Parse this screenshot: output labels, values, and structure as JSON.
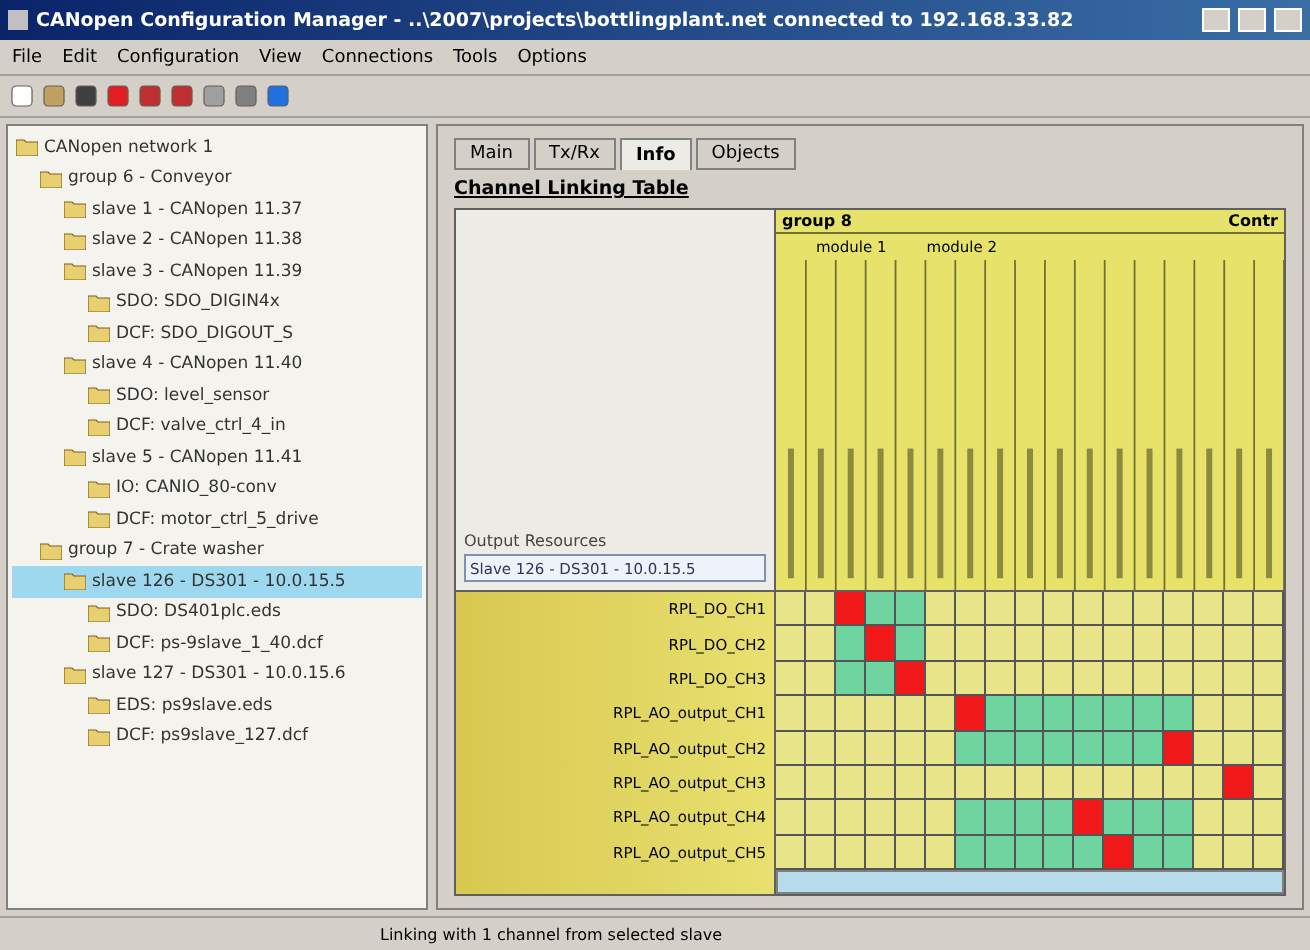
{
  "window": {
    "title": "CANopen Configuration Manager - ..\\2007\\projects\\bottlingplant.net connected to 192.168.33.82"
  },
  "menu": [
    "File",
    "Edit",
    "Configuration",
    "View",
    "Connections",
    "Tools",
    "Options"
  ],
  "tree": [
    {
      "label": "CANopen network 1",
      "selected": false,
      "children": [
        {
          "label": "group 6 - Conveyor",
          "selected": false,
          "children": [
            {
              "label": "slave 1 - CANopen 11.37",
              "selected": false
            },
            {
              "label": "slave 2 - CANopen 11.38",
              "selected": false
            },
            {
              "label": "slave 3 - CANopen 11.39",
              "selected": false,
              "children": [
                {
                  "label": "SDO: SDO_DIGIN4x",
                  "selected": false
                },
                {
                  "label": "DCF: SDO_DIGOUT_S",
                  "selected": false
                }
              ]
            },
            {
              "label": "slave 4 - CANopen 11.40",
              "selected": false,
              "children": [
                {
                  "label": "SDO: level_sensor",
                  "selected": false
                },
                {
                  "label": "DCF: valve_ctrl_4_in",
                  "selected": false
                }
              ]
            },
            {
              "label": "slave 5 - CANopen 11.41",
              "selected": false,
              "children": [
                {
                  "label": "IO: CANIO_80-conv",
                  "selected": false
                },
                {
                  "label": "DCF: motor_ctrl_5_drive",
                  "selected": false
                }
              ]
            }
          ]
        },
        {
          "label": "group 7 - Crate washer",
          "selected": false,
          "children": [
            {
              "label": "slave 126 - DS301 - 10.0.15.5",
              "selected": true,
              "children": [
                {
                  "label": "SDO: DS401plc.eds",
                  "selected": false
                },
                {
                  "label": "DCF: ps-9slave_1_40.dcf",
                  "selected": false
                }
              ]
            },
            {
              "label": "slave 127 - DS301 - 10.0.15.6",
              "selected": false,
              "children": [
                {
                  "label": "EDS: ps9slave.eds",
                  "selected": false
                },
                {
                  "label": "DCF: ps9slave_127.dcf",
                  "selected": false
                }
              ]
            }
          ]
        }
      ]
    }
  ],
  "tabs": [
    {
      "label": "Main",
      "selected": false
    },
    {
      "label": "Tx/Rx",
      "selected": false
    },
    {
      "label": "Info",
      "selected": true
    },
    {
      "label": "Objects",
      "selected": false
    }
  ],
  "heading": "Channel Linking Table",
  "output_resources": {
    "label": "Output Resources",
    "value": "Slave 126 - DS301 - 10.0.15.5"
  },
  "column_groups": [
    {
      "label": "group 8"
    },
    {
      "label": "Contr"
    }
  ],
  "modules": [
    {
      "label": "module 1"
    },
    {
      "label": "module 2"
    }
  ],
  "rows": [
    {
      "label": "RPL_DO_CH1",
      "cells": [
        {
          "kind": "none"
        },
        {
          "kind": "none"
        },
        {
          "kind": "linked"
        },
        {
          "kind": "available"
        },
        {
          "kind": "available"
        },
        {
          "kind": "none"
        },
        {
          "kind": "none"
        },
        {
          "kind": "none"
        },
        {
          "kind": "none"
        },
        {
          "kind": "none"
        },
        {
          "kind": "none"
        },
        {
          "kind": "none"
        },
        {
          "kind": "none"
        },
        {
          "kind": "none"
        },
        {
          "kind": "none"
        },
        {
          "kind": "none"
        },
        {
          "kind": "none"
        }
      ]
    },
    {
      "label": "RPL_DO_CH2",
      "cells": [
        {
          "kind": "none"
        },
        {
          "kind": "none"
        },
        {
          "kind": "available"
        },
        {
          "kind": "linked"
        },
        {
          "kind": "available"
        },
        {
          "kind": "none"
        },
        {
          "kind": "none"
        },
        {
          "kind": "none"
        },
        {
          "kind": "none"
        },
        {
          "kind": "none"
        },
        {
          "kind": "none"
        },
        {
          "kind": "none"
        },
        {
          "kind": "none"
        },
        {
          "kind": "none"
        },
        {
          "kind": "none"
        },
        {
          "kind": "none"
        },
        {
          "kind": "none"
        }
      ]
    },
    {
      "label": "RPL_DO_CH3",
      "cells": [
        {
          "kind": "none"
        },
        {
          "kind": "none"
        },
        {
          "kind": "available"
        },
        {
          "kind": "available"
        },
        {
          "kind": "linked"
        },
        {
          "kind": "none"
        },
        {
          "kind": "none"
        },
        {
          "kind": "none"
        },
        {
          "kind": "none"
        },
        {
          "kind": "none"
        },
        {
          "kind": "none"
        },
        {
          "kind": "none"
        },
        {
          "kind": "none"
        },
        {
          "kind": "none"
        },
        {
          "kind": "none"
        },
        {
          "kind": "none"
        },
        {
          "kind": "none"
        }
      ]
    },
    {
      "label": "RPL_AO_output_CH1",
      "cells": [
        {
          "kind": "none"
        },
        {
          "kind": "none"
        },
        {
          "kind": "none"
        },
        {
          "kind": "none"
        },
        {
          "kind": "none"
        },
        {
          "kind": "none"
        },
        {
          "kind": "linked"
        },
        {
          "kind": "available"
        },
        {
          "kind": "available"
        },
        {
          "kind": "available"
        },
        {
          "kind": "available"
        },
        {
          "kind": "available"
        },
        {
          "kind": "available"
        },
        {
          "kind": "available"
        },
        {
          "kind": "none"
        },
        {
          "kind": "none"
        },
        {
          "kind": "none"
        }
      ]
    },
    {
      "label": "RPL_AO_output_CH2",
      "cells": [
        {
          "kind": "none"
        },
        {
          "kind": "none"
        },
        {
          "kind": "none"
        },
        {
          "kind": "none"
        },
        {
          "kind": "none"
        },
        {
          "kind": "none"
        },
        {
          "kind": "available"
        },
        {
          "kind": "available"
        },
        {
          "kind": "available"
        },
        {
          "kind": "available"
        },
        {
          "kind": "available"
        },
        {
          "kind": "available"
        },
        {
          "kind": "available"
        },
        {
          "kind": "linked"
        },
        {
          "kind": "none"
        },
        {
          "kind": "none"
        },
        {
          "kind": "none"
        }
      ]
    },
    {
      "label": "RPL_AO_output_CH3",
      "cells": [
        {
          "kind": "none"
        },
        {
          "kind": "none"
        },
        {
          "kind": "none"
        },
        {
          "kind": "none"
        },
        {
          "kind": "none"
        },
        {
          "kind": "none"
        },
        {
          "kind": "none"
        },
        {
          "kind": "none"
        },
        {
          "kind": "none"
        },
        {
          "kind": "none"
        },
        {
          "kind": "none"
        },
        {
          "kind": "none"
        },
        {
          "kind": "none"
        },
        {
          "kind": "none"
        },
        {
          "kind": "none"
        },
        {
          "kind": "linked"
        },
        {
          "kind": "none"
        }
      ]
    },
    {
      "label": "RPL_AO_output_CH4",
      "cells": [
        {
          "kind": "none"
        },
        {
          "kind": "none"
        },
        {
          "kind": "none"
        },
        {
          "kind": "none"
        },
        {
          "kind": "none"
        },
        {
          "kind": "none"
        },
        {
          "kind": "available"
        },
        {
          "kind": "available"
        },
        {
          "kind": "available"
        },
        {
          "kind": "available"
        },
        {
          "kind": "linked"
        },
        {
          "kind": "available"
        },
        {
          "kind": "available"
        },
        {
          "kind": "available"
        },
        {
          "kind": "none"
        },
        {
          "kind": "none"
        },
        {
          "kind": "none"
        }
      ]
    },
    {
      "label": "RPL_AO_output_CH5",
      "cells": [
        {
          "kind": "none"
        },
        {
          "kind": "none"
        },
        {
          "kind": "none"
        },
        {
          "kind": "none"
        },
        {
          "kind": "none"
        },
        {
          "kind": "none"
        },
        {
          "kind": "available"
        },
        {
          "kind": "available"
        },
        {
          "kind": "available"
        },
        {
          "kind": "available"
        },
        {
          "kind": "available"
        },
        {
          "kind": "linked"
        },
        {
          "kind": "available"
        },
        {
          "kind": "available"
        },
        {
          "kind": "none"
        },
        {
          "kind": "none"
        },
        {
          "kind": "none"
        }
      ]
    }
  ],
  "status_bar": "Linking with 1 channel from selected slave"
}
